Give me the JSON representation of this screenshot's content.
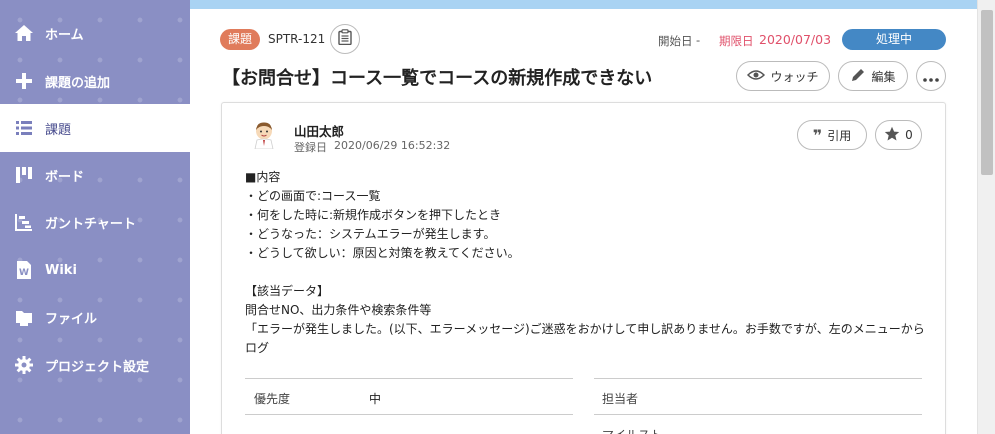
{
  "sidebar": {
    "items": [
      {
        "label": "ホーム",
        "icon": "home-icon"
      },
      {
        "label": "課題の追加",
        "icon": "plus-icon"
      },
      {
        "label": "課題",
        "icon": "list-icon"
      },
      {
        "label": "ボード",
        "icon": "board-icon"
      },
      {
        "label": "ガントチャート",
        "icon": "gantt-icon"
      },
      {
        "label": "Wiki",
        "icon": "wiki-icon"
      },
      {
        "label": "ファイル",
        "icon": "folder-icon"
      },
      {
        "label": "プロジェクト設定",
        "icon": "gear-icon"
      }
    ]
  },
  "issue": {
    "type": "課題",
    "key": "SPTR-121",
    "start_label": "開始日",
    "start_value": "-",
    "due_label": "期限日",
    "due_value": "2020/07/03",
    "status": "処理中",
    "title": "【お問合せ】コース一覧でコースの新規作成できない"
  },
  "actions": {
    "watch": "ウォッチ",
    "edit": "編集"
  },
  "comment": {
    "author": "山田太郎",
    "registered_label": "登録日",
    "registered_at": "2020/06/29 16:52:32",
    "quote": "引用",
    "star_count": "0",
    "lines": [
      "■内容",
      "・どの画面で:コース一覧",
      "・何をした時に:新規作成ボタンを押下したとき",
      "・どうなった：システムエラーが発生します。",
      "・どうして欲しい：原因と対策を教えてください。",
      "",
      "【該当データ】",
      "問合せNO、出力条件や検索条件等",
      "「エラーが発生しました。(以下、エラーメッセージ)ご迷惑をおかけして申し訳ありません。お手数ですが、左のメニューからログ"
    ]
  },
  "properties": {
    "priority_label": "優先度",
    "priority_value": "中",
    "assignee_label": "担当者",
    "milestone_label": "マイルスト"
  },
  "colors": {
    "sidebar": "#8a8fc4",
    "type_badge": "#e07b5b",
    "status_badge": "#4488c5",
    "due": "#e0506a"
  }
}
